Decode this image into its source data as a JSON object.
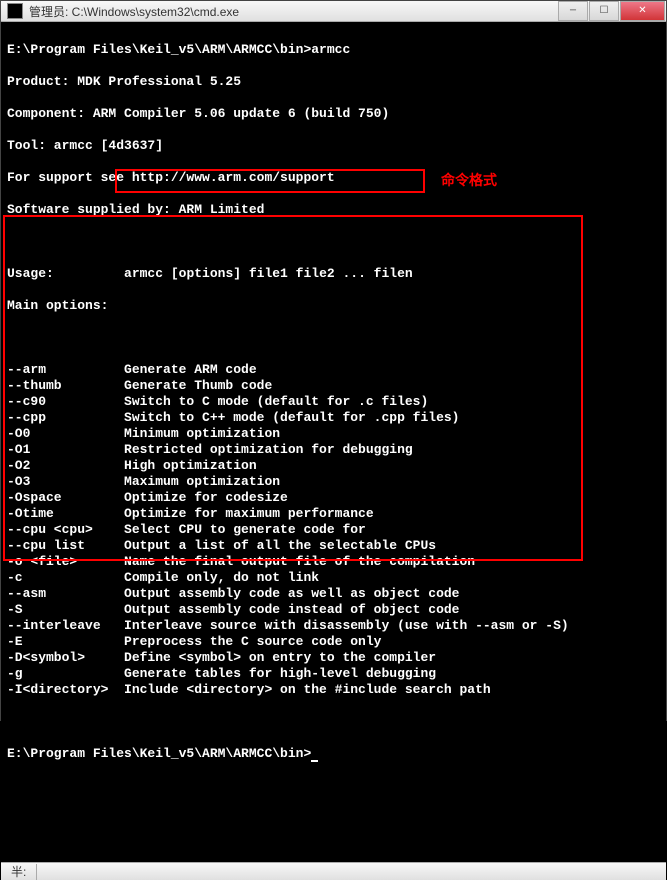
{
  "window": {
    "title": "管理员: C:\\Windows\\system32\\cmd.exe"
  },
  "terminal": {
    "line1": "E:\\Program Files\\Keil_v5\\ARM\\ARMCC\\bin>armcc",
    "line2": "Product: MDK Professional 5.25",
    "line3": "Component: ARM Compiler 5.06 update 6 (build 750)",
    "line4": "Tool: armcc [4d3637]",
    "line5": "For support see http://www.arm.com/support",
    "line6": "Software supplied by: ARM Limited",
    "usage_label": "Usage:",
    "usage_text": "armcc [options] file1 file2 ... filen",
    "main_options_label": "Main options:",
    "usage_annotation": "命令格式",
    "options": [
      {
        "flag": "--arm",
        "desc": "Generate ARM code"
      },
      {
        "flag": "--thumb",
        "desc": "Generate Thumb code"
      },
      {
        "flag": "--c90",
        "desc": "Switch to C mode (default for .c files)"
      },
      {
        "flag": "--cpp",
        "desc": "Switch to C++ mode (default for .cpp files)"
      },
      {
        "flag": "-O0",
        "desc": "Minimum optimization"
      },
      {
        "flag": "-O1",
        "desc": "Restricted optimization for debugging"
      },
      {
        "flag": "-O2",
        "desc": "High optimization"
      },
      {
        "flag": "-O3",
        "desc": "Maximum optimization"
      },
      {
        "flag": "-Ospace",
        "desc": "Optimize for codesize"
      },
      {
        "flag": "-Otime",
        "desc": "Optimize for maximum performance"
      },
      {
        "flag": "--cpu <cpu>",
        "desc": "Select CPU to generate code for"
      },
      {
        "flag": "--cpu list",
        "desc": "Output a list of all the selectable CPUs"
      },
      {
        "flag": "-o <file>",
        "desc": "Name the final output file of the compilation"
      },
      {
        "flag": "-c",
        "desc": "Compile only, do not link"
      },
      {
        "flag": "--asm",
        "desc": "Output assembly code as well as object code"
      },
      {
        "flag": "-S",
        "desc": "Output assembly code instead of object code"
      },
      {
        "flag": "--interleave",
        "desc": "Interleave source with disassembly (use with --asm or -S)"
      },
      {
        "flag": "-E",
        "desc": "Preprocess the C source code only"
      },
      {
        "flag": "-D<symbol>",
        "desc": "Define <symbol> on entry to the compiler"
      },
      {
        "flag": "-g",
        "desc": "Generate tables for high-level debugging"
      },
      {
        "flag": "-I<directory>",
        "desc": "Include <directory> on the #include search path"
      }
    ],
    "prompt": "E:\\Program Files\\Keil_v5\\ARM\\ARMCC\\bin>"
  },
  "statusbar": {
    "ime": "半:"
  }
}
